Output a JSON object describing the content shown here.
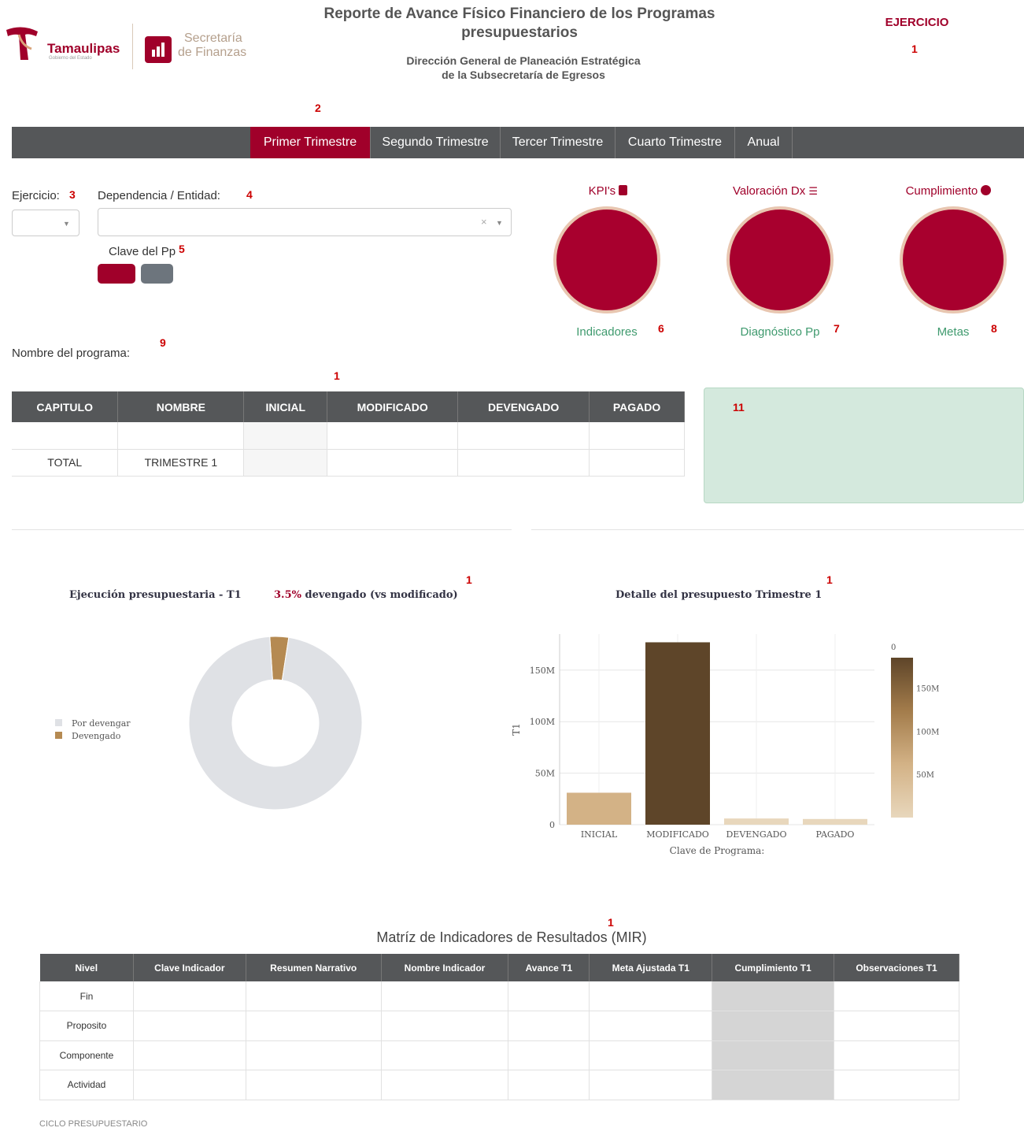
{
  "header": {
    "tamaulipas_logo": "Tamaulipas",
    "tamaulipas_sub": "Gobierno del Estado",
    "finanzas_line1": "Secretaría",
    "finanzas_line2": "de Finanzas",
    "title_line1": "Reporte de Avance Físico Financiero de los Programas",
    "title_line2": "presupuestarios",
    "subtitle_line1": "Dirección General de Planeación Estratégica",
    "subtitle_line2": "de la Subsecretaría de Egresos",
    "ejercicio_label": "EJERCICIO"
  },
  "markers": {
    "m1": "1",
    "m2": "2",
    "m3": "3",
    "m4": "4",
    "m5": "5",
    "m6": "6",
    "m7": "7",
    "m8": "8",
    "m9": "9",
    "m11": "11"
  },
  "tabs": [
    "Primer Trimestre",
    "Segundo Trimestre",
    "Tercer Trimestre",
    "Cuarto Trimestre",
    "Anual"
  ],
  "filters": {
    "ejercicio_label": "Ejercicio:",
    "dependencia_label": "Dependencia / Entidad:",
    "clave_label": "Clave del Pp",
    "clear_glyph": "×",
    "nombre_programa_label": "Nombre del programa:"
  },
  "kpis": [
    {
      "head": "KPI's",
      "foot": "Indicadores"
    },
    {
      "head": "Valoración Dx",
      "foot": "Diagnóstico Pp"
    },
    {
      "head": "Cumplimiento",
      "foot": "Metas"
    }
  ],
  "budget_table": {
    "headers": [
      "CAPITULO",
      "NOMBRE",
      "INICIAL",
      "MODIFICADO",
      "DEVENGADO",
      "PAGADO"
    ],
    "total_row": [
      "TOTAL",
      "TRIMESTRE 1"
    ]
  },
  "donut": {
    "title": "Ejecución presupuestaria - T1",
    "percent": "3.5%",
    "percent_suffix": " devengado (vs modificado)",
    "legend": [
      "Por devengar",
      "Devengado"
    ]
  },
  "bar_chart_text": {
    "title": "Detalle del presupuesto Trimestre 1",
    "xlabel": "Clave de Programa:",
    "ylabel": "T1",
    "y_ticks": [
      "0",
      "50M",
      "100M",
      "150M"
    ],
    "colorbar_ticks": [
      "0",
      "50M",
      "100M",
      "150M"
    ]
  },
  "chart_data": [
    {
      "type": "pie",
      "title": "Ejecución presupuestaria - T1",
      "labels": [
        "Por devengar",
        "Devengado"
      ],
      "values": [
        96.5,
        3.5
      ],
      "colors": [
        "#dfe1e5",
        "#b58a52"
      ],
      "hole": 0.5
    },
    {
      "type": "bar",
      "title": "Detalle del presupuesto Trimestre 1",
      "categories": [
        "INICIAL",
        "MODIFICADO",
        "DEVENGADO",
        "PAGADO"
      ],
      "values": [
        31000000,
        177000000,
        6000000,
        5500000
      ],
      "xlabel": "Clave de Programa:",
      "ylabel": "T1",
      "ylim": [
        0,
        185000000
      ],
      "colorscale": [
        "#e8d7bc",
        "#d3b286",
        "#a37c4b",
        "#5e4529"
      ]
    }
  ],
  "mir": {
    "title": "Matríz de Indicadores de Resultados (MIR)",
    "headers": [
      "Nivel",
      "Clave Indicador",
      "Resumen Narrativo",
      "Nombre Indicador",
      "Avance T1",
      "Meta Ajustada T1",
      "Cumplimiento T1",
      "Observaciones T1"
    ],
    "rows": [
      "Fin",
      "Proposito",
      "Componente",
      "Actividad"
    ],
    "footer": "CICLO PRESUPUESTARIO"
  },
  "colors": {
    "brand": "#a0002a",
    "nav": "#555759",
    "green_box": "#d4e9dd",
    "kpi_foot": "#3f9a6e"
  }
}
